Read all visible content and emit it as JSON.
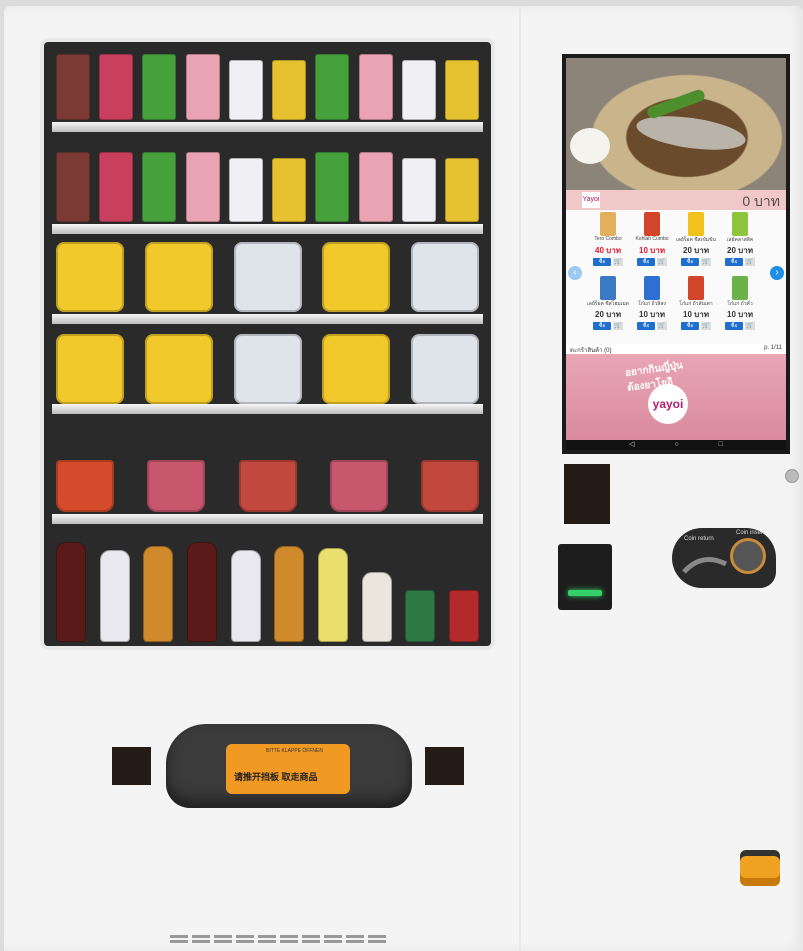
{
  "screen": {
    "balance_text": "0 บาท",
    "logo_text": "Yayoi",
    "products": [
      {
        "name": "Tero Combo",
        "price": "40 บาท",
        "buy": "ซื้อ",
        "cart_icon": "cart-icon",
        "color": "#e2b05d"
      },
      {
        "name": "Kohlah Combo",
        "price": "10 บาท",
        "buy": "ซื้อ",
        "cart_icon": "cart-icon",
        "color": "#d2452b"
      },
      {
        "name": "เลย์ร็อค ชีสเข้มข้น",
        "price": "20 บาท",
        "buy": "ซื้อ",
        "cart_icon": "cart-icon",
        "color": "#f3c11c"
      },
      {
        "name": "เลย์คลาสสิค",
        "price": "20 บาท",
        "buy": "ซื้อ",
        "cart_icon": "cart-icon",
        "color": "#8fc53b"
      },
      {
        "name": "เลย์ร็อค ชีสโฮมเมด",
        "price": "20 บาท",
        "buy": "ซื้อ",
        "cart_icon": "cart-icon",
        "color": "#3b79c5"
      },
      {
        "name": "โก๋แก่ ถั่วลิสง",
        "price": "10 บาท",
        "buy": "ซื้อ",
        "cart_icon": "cart-icon",
        "color": "#2f6fcf"
      },
      {
        "name": "โก๋แก่ ถั่วลันเตา",
        "price": "10 บาท",
        "buy": "ซื้อ",
        "cart_icon": "cart-icon",
        "color": "#d2452b"
      },
      {
        "name": "โก๋แก่ ถั่วคั่ว",
        "price": "10 บาท",
        "buy": "ซื้อ",
        "cart_icon": "cart-icon",
        "color": "#6cb24a"
      }
    ],
    "cart_label": "ตะกร้าสินค้า (0)",
    "page_label": "p. 1/11",
    "banner_title": "อยากกินญี่ปุ่น",
    "banner_subtitle": "ต้องยาโยอิ",
    "banner_logo": "yayoi",
    "nav_back": "◁",
    "nav_home": "○",
    "nav_recent": "□"
  },
  "pickup": {
    "notice": "请推开挡板 取走商品",
    "small_print": "BITTE KLAPPE ÖFFNEN"
  },
  "coin": {
    "return_label": "Coin return",
    "insert_label": "Coin insert"
  },
  "colors": {
    "price_red": "#e0192e",
    "price_blue": "#1f6fd1",
    "arrow_blue": "#1f8ee6",
    "accent_orange": "#f19a23"
  }
}
